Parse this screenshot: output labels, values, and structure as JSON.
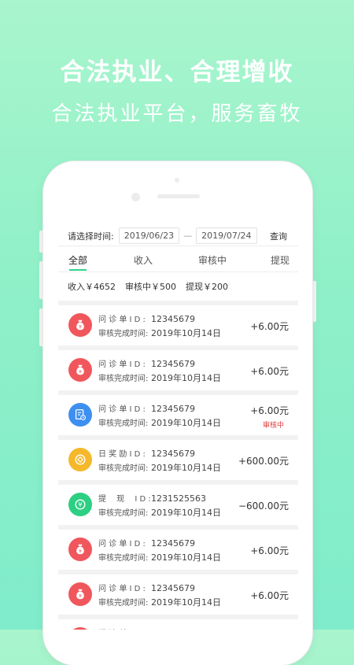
{
  "banner": {
    "headline": "合法执业、合理增收",
    "subheadline": "合法执业平台，服务畜牧"
  },
  "filter": {
    "label": "请选择时间:",
    "start_date": "2019/06/23",
    "separator": "—",
    "end_date": "2019/07/24",
    "query_label": "查询"
  },
  "tabs": [
    {
      "label": "全部",
      "active": true
    },
    {
      "label": "收入",
      "active": false
    },
    {
      "label": "审核中",
      "active": false
    },
    {
      "label": "提现",
      "active": false
    }
  ],
  "summary": {
    "income": "收入￥4652",
    "reviewing": "审核中￥500",
    "withdraw": "提现￥200"
  },
  "records": [
    {
      "icon": "money-bag-icon",
      "color": "#f0575c",
      "id_label": "问 诊 单 I D :",
      "id": "12345679",
      "time_label": "审核完成时间:",
      "time": "2019年10月14日",
      "amount": "+6.00元",
      "badge": ""
    },
    {
      "icon": "money-bag-icon",
      "color": "#f0575c",
      "id_label": "问 诊 单 I D :",
      "id": "12345679",
      "time_label": "审核完成时间:",
      "time": "2019年10月14日",
      "amount": "+6.00元",
      "badge": ""
    },
    {
      "icon": "document-icon",
      "color": "#3d8ff0",
      "id_label": "问 诊 单 I D :",
      "id": "12345679",
      "time_label": "审核完成时间:",
      "time": "2019年10月14日",
      "amount": "+6.00元",
      "badge": "审核中"
    },
    {
      "icon": "coin-reward-icon",
      "color": "#f5b82b",
      "id_label": "日 奖 励 I D :",
      "id": "12345679",
      "time_label": "审核完成时间:",
      "time": "2019年10月14日",
      "amount": "+600.00元",
      "badge": ""
    },
    {
      "icon": "yen-coin-icon",
      "color": "#2dcf82",
      "id_label": "提 　现 　I D :",
      "id": "1231525563",
      "time_label": "审核完成时间:",
      "time": "2019年10月14日",
      "amount": "−600.00元",
      "badge": ""
    },
    {
      "icon": "money-bag-icon",
      "color": "#f0575c",
      "id_label": "问 诊 单 I D :",
      "id": "12345679",
      "time_label": "审核完成时间:",
      "time": "2019年10月14日",
      "amount": "+6.00元",
      "badge": ""
    },
    {
      "icon": "money-bag-icon",
      "color": "#f0575c",
      "id_label": "问 诊 单 I D :",
      "id": "12345679",
      "time_label": "审核完成时间:",
      "time": "2019年10月14日",
      "amount": "+6.00元",
      "badge": ""
    },
    {
      "icon": "money-bag-icon",
      "color": "#f0575c",
      "id_label": "问 诊 单 I D :",
      "id": "12345679",
      "time_label": "",
      "time": "",
      "amount": "",
      "badge": ""
    }
  ]
}
